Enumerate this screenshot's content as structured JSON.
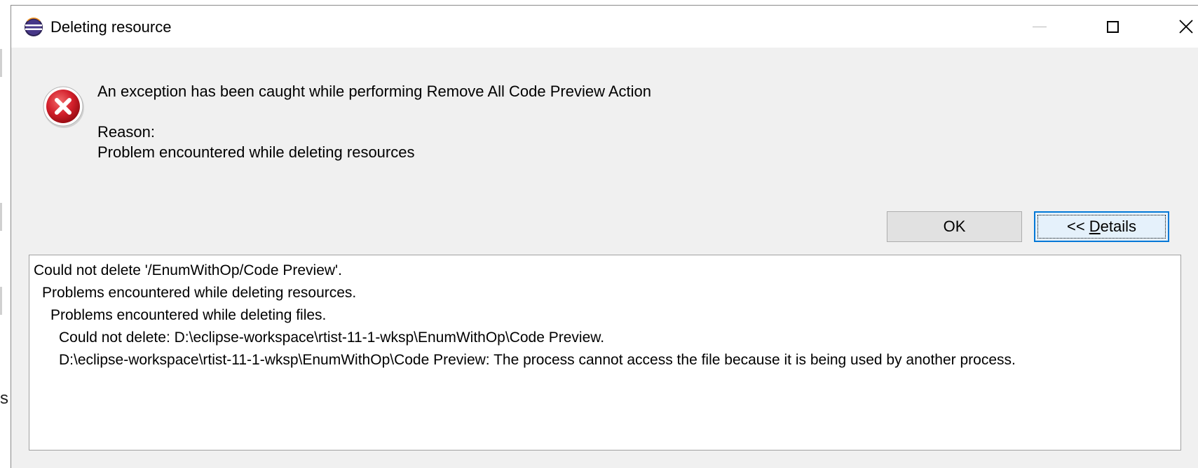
{
  "window": {
    "title": "Deleting resource",
    "icon": "eclipse-icon",
    "controls": {
      "minimize": "minimize-icon",
      "maximize": "maximize-icon",
      "close": "close-icon"
    }
  },
  "message": {
    "icon": "error-icon",
    "main": "An exception has been caught while performing Remove All Code Preview Action",
    "reason_label": "Reason:",
    "reason_text": "Problem encountered while deleting resources"
  },
  "buttons": {
    "ok_label": "OK",
    "details_prefix": "<< ",
    "details_mnemonic": "D",
    "details_rest": "etails"
  },
  "details": {
    "lines": [
      "Could not delete '/EnumWithOp/Code Preview'.",
      "Problems encountered while deleting resources.",
      "Problems encountered while deleting files.",
      "Could not delete: D:\\eclipse-workspace\\rtist-11-1-wksp\\EnumWithOp\\Code Preview.",
      "D:\\eclipse-workspace\\rtist-11-1-wksp\\EnumWithOp\\Code Preview: The process cannot access the file because it is being used by another process."
    ]
  },
  "backdrop": {
    "glyph": "s"
  },
  "colors": {
    "dialog_bg": "#f0f0f0",
    "titlebar_bg": "#ffffff",
    "error_red": "#c8102e",
    "focus_blue": "#0078d7"
  }
}
